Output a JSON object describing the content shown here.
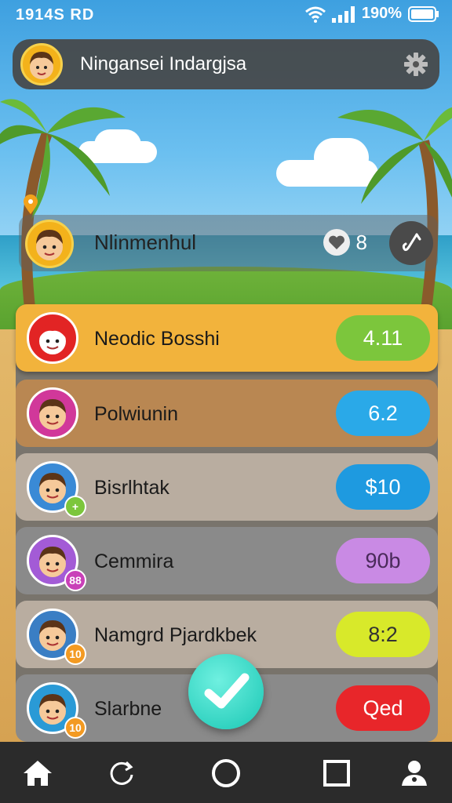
{
  "status_bar": {
    "time": "1914S RD",
    "battery": "190%"
  },
  "header": {
    "title": "Ningansei Indargjsa"
  },
  "featured": {
    "name": "Nlinmenhul",
    "likes": "8"
  },
  "players": [
    {
      "name": "Neodic Bosshi",
      "score": "4.11",
      "row_color": "#f2b33c",
      "pill_color": "#7cc63c",
      "pill_text_color": "#ffffff"
    },
    {
      "name": "Polwiunin",
      "score": "6.2",
      "row_color": "#b98752",
      "pill_color": "#2aa9e8",
      "pill_text_color": "#ffffff"
    },
    {
      "name": "Bisrlhtak",
      "score": "$10",
      "row_color": "#b9ada0",
      "pill_color": "#1e9ae0",
      "pill_text_color": "#ffffff"
    },
    {
      "name": "Cemmira",
      "score": "90b",
      "row_color": "#8a8a8a",
      "pill_color": "#c98ae4",
      "pill_text_color": "#4a2a5a"
    },
    {
      "name": "Namgrd Pjardkbek",
      "score": "8:2",
      "row_color": "#b9ada0",
      "pill_color": "#d8e92a",
      "pill_text_color": "#333333"
    },
    {
      "name": "Slarbne",
      "score": "Qed",
      "row_color": "#8a8a8a",
      "pill_color": "#e8262a",
      "pill_text_color": "#ffffff"
    }
  ],
  "nav": {
    "items": [
      "home-icon",
      "refresh-icon",
      "circle-icon",
      "square-icon",
      "user-icon"
    ]
  }
}
